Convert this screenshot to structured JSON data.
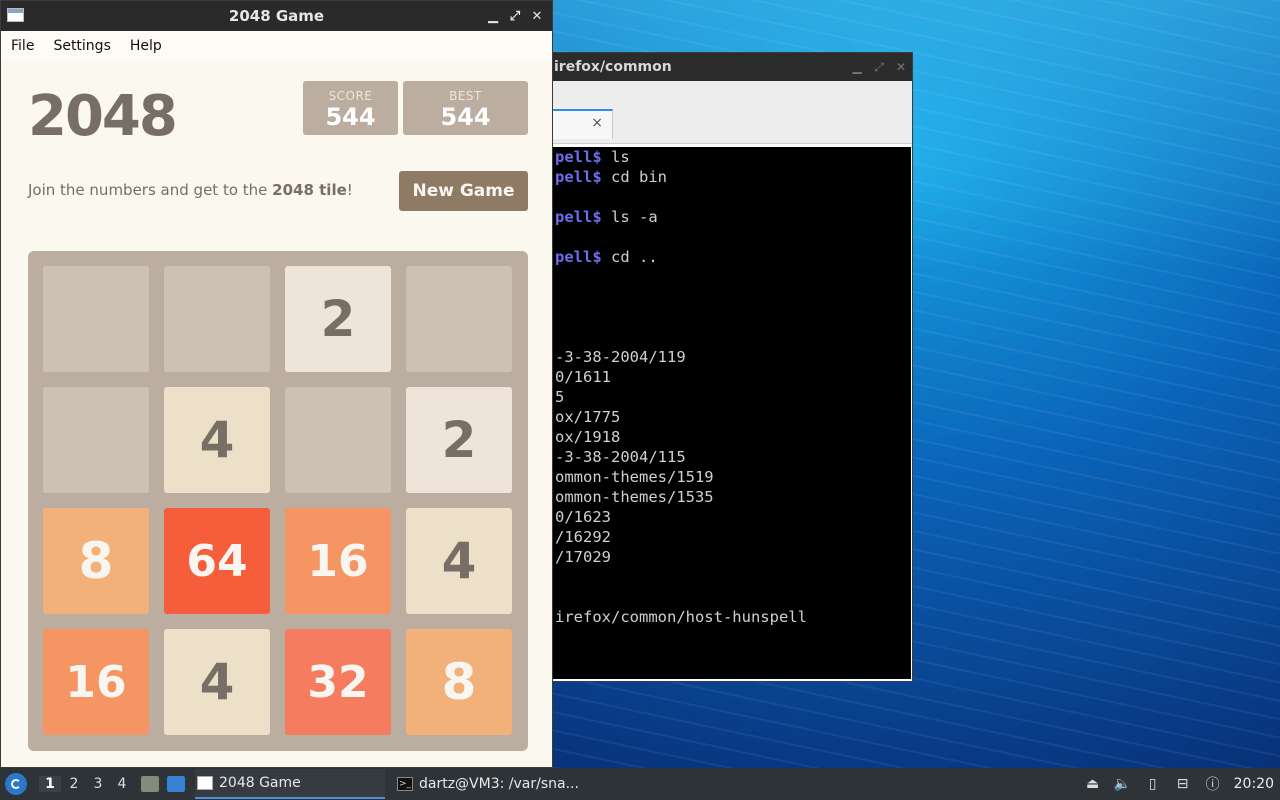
{
  "game_window": {
    "title": "2048 Game",
    "menu": [
      "File",
      "Settings",
      "Help"
    ],
    "heading": "2048",
    "score_label": "SCORE",
    "score": "544",
    "best_label": "BEST",
    "best": "544",
    "tagline_prefix": "Join the numbers and get to the ",
    "tagline_bold": "2048 tile",
    "tagline_suffix": "!",
    "new_game_label": "New Game",
    "board": [
      [
        "",
        "",
        "2",
        ""
      ],
      [
        "",
        "4",
        "",
        "2"
      ],
      [
        "8",
        "64",
        "16",
        "4"
      ],
      [
        "16",
        "4",
        "32",
        "8"
      ]
    ],
    "tile_colors": {
      "": {
        "bg": "#cdc1b4",
        "fg": "#776e65"
      },
      "2": {
        "bg": "#eee4da",
        "fg": "#776e65"
      },
      "4": {
        "bg": "#ede0c8",
        "fg": "#776e65"
      },
      "8": {
        "bg": "#f2b179",
        "fg": "#f9f6f2"
      },
      "16": {
        "bg": "#f59563",
        "fg": "#f9f6f2"
      },
      "32": {
        "bg": "#f67c5f",
        "fg": "#f9f6f2"
      },
      "64": {
        "bg": "#f65e3b",
        "fg": "#f9f6f2"
      }
    }
  },
  "terminal_window": {
    "title": "irefox/common",
    "tab_close": "×",
    "lines": [
      {
        "prompt": "pell$",
        "cmd": " ls"
      },
      {
        "prompt": "pell$",
        "cmd": " cd bin"
      },
      {
        "prompt": "",
        "cmd": ""
      },
      {
        "prompt": "pell$",
        "cmd": " ls -a"
      },
      {
        "prompt": "",
        "cmd": ""
      },
      {
        "prompt": "pell$",
        "cmd": " cd .."
      },
      {
        "prompt": "",
        "cmd": ""
      },
      {
        "prompt": "",
        "cmd": ""
      },
      {
        "prompt": "",
        "cmd": ""
      },
      {
        "prompt": "",
        "cmd": ""
      },
      {
        "prompt": "",
        "cmd": "-3-38-2004/119"
      },
      {
        "prompt": "",
        "cmd": "0/1611"
      },
      {
        "prompt": "",
        "cmd": "5"
      },
      {
        "prompt": "",
        "cmd": "ox/1775"
      },
      {
        "prompt": "",
        "cmd": "ox/1918"
      },
      {
        "prompt": "",
        "cmd": "-3-38-2004/115"
      },
      {
        "prompt": "",
        "cmd": "ommon-themes/1519"
      },
      {
        "prompt": "",
        "cmd": "ommon-themes/1535"
      },
      {
        "prompt": "",
        "cmd": "0/1623"
      },
      {
        "prompt": "",
        "cmd": "/16292"
      },
      {
        "prompt": "",
        "cmd": "/17029"
      },
      {
        "prompt": "",
        "cmd": ""
      },
      {
        "prompt": "",
        "cmd": ""
      },
      {
        "prompt": "",
        "cmd": "irefox/common/host-hunspell"
      }
    ]
  },
  "taskbar": {
    "workspaces": [
      "1",
      "2",
      "3",
      "4"
    ],
    "active_workspace": "1",
    "tasks": [
      {
        "label": "2048 Game",
        "active": true,
        "icon": "window-icon"
      },
      {
        "label": "dartz@VM3: /var/sna...",
        "active": false,
        "icon": "terminal-icon"
      }
    ],
    "clock": "20:20"
  }
}
